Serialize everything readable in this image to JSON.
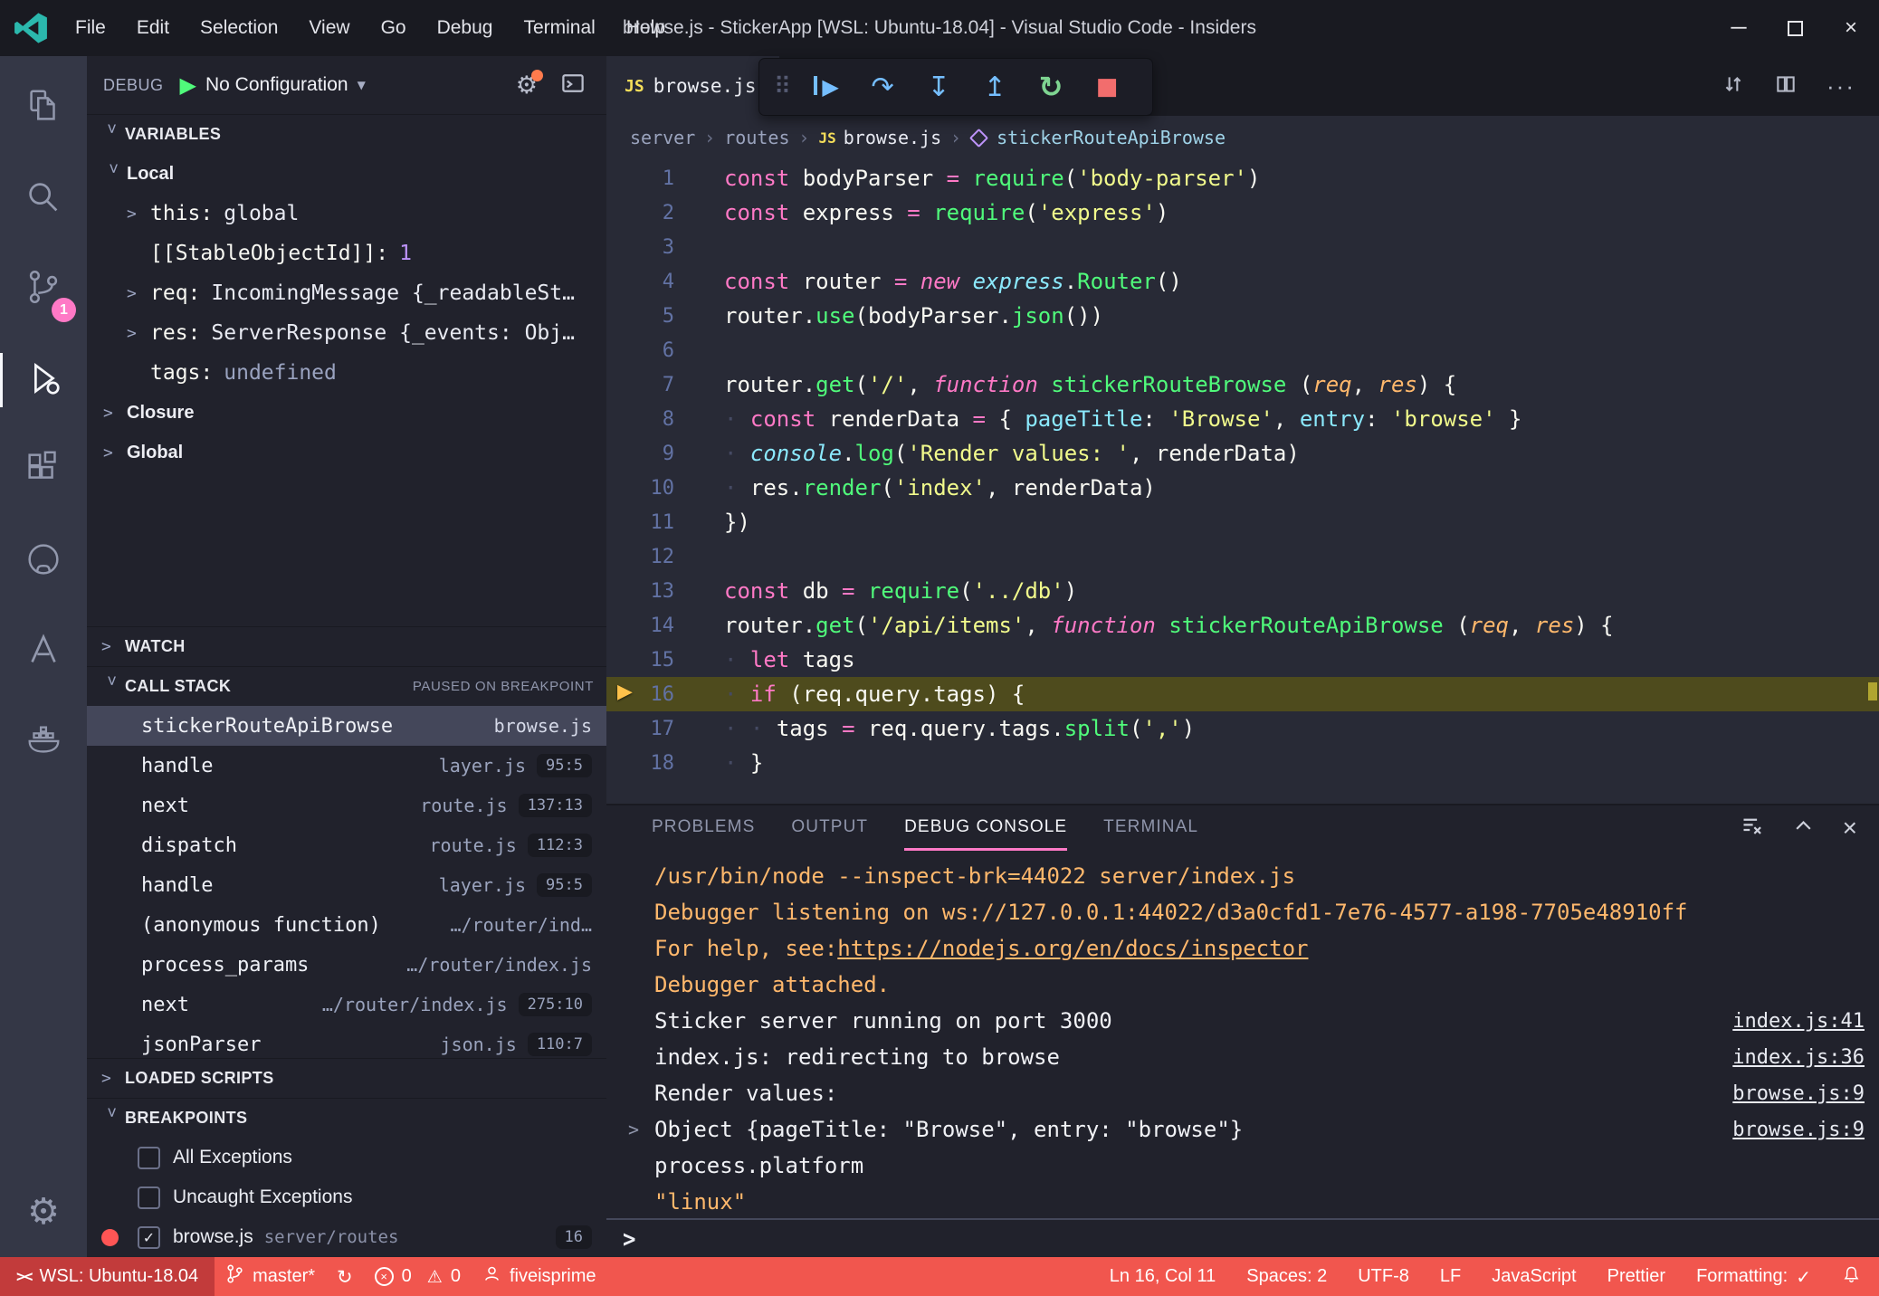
{
  "colors": {
    "title-bg": "#191a21",
    "activity-bg": "#343746",
    "side-bg": "#21222c",
    "editor-bg": "#282a36",
    "fg": "#f8f8f2",
    "dim": "#6272a4",
    "pink": "#ff79c6",
    "green": "#50fa7b",
    "yellow": "#f1fa8c",
    "orange": "#ffb86c",
    "purple": "#bd93f9",
    "cyan": "#8be9fd",
    "red": "#ff5555",
    "blue": "#75beff",
    "selection": "#44475a",
    "status-bg": "#f1564e",
    "status-remote-bg": "#c23b3b",
    "debug-line-bg": "#4e4b1d",
    "debug-arrow": "#ffc24b"
  },
  "title_bar": {
    "menus": [
      "File",
      "Edit",
      "Selection",
      "View",
      "Go",
      "Debug",
      "Terminal",
      "Help"
    ],
    "title": "browse.js - StickerApp [WSL: Ubuntu-18.04] - Visual Studio Code - Insiders"
  },
  "activity_bar": {
    "scm_badge": "1"
  },
  "debug_sidebar": {
    "header": {
      "label": "DEBUG",
      "config": "No Configuration"
    },
    "variables": {
      "title": "VARIABLES",
      "rows": [
        {
          "scope": true,
          "chev": "open",
          "label": "Local",
          "depth": 0
        },
        {
          "chev": "closed",
          "name": "this",
          "value": "global",
          "depth": 1
        },
        {
          "name": "[[StableObjectId]]",
          "value": "1",
          "depth": 1,
          "vc": "num"
        },
        {
          "chev": "closed",
          "name": "req",
          "value": "IncomingMessage {_readableSt…",
          "depth": 1
        },
        {
          "chev": "closed",
          "name": "res",
          "value": "ServerResponse {_events: Obj…",
          "depth": 1
        },
        {
          "name": "tags",
          "value": "undefined",
          "depth": 1,
          "vc": "undef"
        },
        {
          "scope": true,
          "chev": "closed",
          "label": "Closure",
          "depth": 0
        },
        {
          "scope": true,
          "chev": "closed",
          "label": "Global",
          "depth": 0
        }
      ]
    },
    "watch": {
      "title": "WATCH"
    },
    "call_stack": {
      "title": "CALL STACK",
      "status": "PAUSED ON BREAKPOINT",
      "frames": [
        {
          "name": "stickerRouteApiBrowse",
          "file": "browse.js",
          "selected": true
        },
        {
          "name": "handle",
          "file": "layer.js",
          "pos": "95:5"
        },
        {
          "name": "next",
          "file": "route.js",
          "pos": "137:13"
        },
        {
          "name": "dispatch",
          "file": "route.js",
          "pos": "112:3"
        },
        {
          "name": "handle",
          "file": "layer.js",
          "pos": "95:5"
        },
        {
          "name": "(anonymous function)",
          "file": "…/router/ind…"
        },
        {
          "name": "process_params",
          "file": "…/router/index.js"
        },
        {
          "name": "next",
          "file": "…/router/index.js",
          "pos": "275:10"
        },
        {
          "name": "jsonParser",
          "file": "json.js",
          "pos": "110:7"
        }
      ]
    },
    "loaded_scripts": {
      "title": "LOADED SCRIPTS"
    },
    "breakpoints": {
      "title": "BREAKPOINTS",
      "items": [
        {
          "label": "All Exceptions",
          "checked": false
        },
        {
          "label": "Uncaught Exceptions",
          "checked": false
        },
        {
          "label": "browse.js",
          "detail": "server/routes",
          "checked": true,
          "dot": true,
          "badge": "16"
        }
      ]
    }
  },
  "debug_toolbar": {
    "buttons": [
      {
        "name": "continue",
        "glyph": "▶",
        "color": "blue"
      },
      {
        "name": "step-over",
        "glyph": "↷",
        "color": "blue"
      },
      {
        "name": "step-into",
        "glyph": "↧",
        "color": "blue"
      },
      {
        "name": "step-out",
        "glyph": "↥",
        "color": "blue"
      },
      {
        "name": "restart",
        "glyph": "↻",
        "color": "green"
      },
      {
        "name": "stop",
        "glyph": "■",
        "color": "red"
      }
    ]
  },
  "editor": {
    "tab": {
      "label": "browse.js"
    },
    "js_badge": "JS",
    "breadcrumbs": [
      {
        "label": "server"
      },
      {
        "label": "routes"
      },
      {
        "label": "browse.js",
        "icon": "js"
      },
      {
        "label": "stickerRouteApiBrowse",
        "icon": "method"
      }
    ],
    "current_line": 16,
    "lines": [
      {
        "n": 1,
        "ind": 0,
        "t": [
          [
            "kw",
            "const"
          ],
          [
            "fg",
            " bodyParser "
          ],
          [
            "kw",
            "="
          ],
          [
            "fg",
            " "
          ],
          [
            "fn",
            "require"
          ],
          [
            "fg",
            "("
          ],
          [
            "str",
            "'body-parser'"
          ],
          [
            "fg",
            ")"
          ]
        ]
      },
      {
        "n": 2,
        "ind": 0,
        "t": [
          [
            "kw",
            "const"
          ],
          [
            "fg",
            " express "
          ],
          [
            "kw",
            "="
          ],
          [
            "fg",
            " "
          ],
          [
            "fn",
            "require"
          ],
          [
            "fg",
            "("
          ],
          [
            "str",
            "'express'"
          ],
          [
            "fg",
            ")"
          ]
        ]
      },
      {
        "n": 3,
        "ind": 0,
        "t": []
      },
      {
        "n": 4,
        "ind": 0,
        "t": [
          [
            "kw",
            "const"
          ],
          [
            "fg",
            " router "
          ],
          [
            "kw",
            "="
          ],
          [
            "fg",
            " "
          ],
          [
            "kwi",
            "new"
          ],
          [
            "fg",
            " "
          ],
          [
            "itc",
            "express"
          ],
          [
            "fg",
            "."
          ],
          [
            "fn",
            "Router"
          ],
          [
            "fg",
            "()"
          ]
        ]
      },
      {
        "n": 5,
        "ind": 0,
        "t": [
          [
            "fg",
            "router."
          ],
          [
            "fn",
            "use"
          ],
          [
            "fg",
            "(bodyParser."
          ],
          [
            "fn",
            "json"
          ],
          [
            "fg",
            "())"
          ]
        ]
      },
      {
        "n": 6,
        "ind": 0,
        "t": []
      },
      {
        "n": 7,
        "ind": 0,
        "t": [
          [
            "fg",
            "router."
          ],
          [
            "fn",
            "get"
          ],
          [
            "fg",
            "("
          ],
          [
            "str",
            "'/'"
          ],
          [
            "fg",
            ", "
          ],
          [
            "kwi",
            "function"
          ],
          [
            "fg",
            " "
          ],
          [
            "fn",
            "stickerRouteBrowse"
          ],
          [
            "fg",
            " ("
          ],
          [
            "ito",
            "req"
          ],
          [
            "fg",
            ", "
          ],
          [
            "ito",
            "res"
          ],
          [
            "fg",
            ") {"
          ]
        ]
      },
      {
        "n": 8,
        "ind": 1,
        "t": [
          [
            "kw",
            "const"
          ],
          [
            "fg",
            " renderData "
          ],
          [
            "kw",
            "="
          ],
          [
            "fg",
            " { "
          ],
          [
            "prop",
            "pageTitle"
          ],
          [
            "fg",
            ": "
          ],
          [
            "str",
            "'Browse'"
          ],
          [
            "fg",
            ", "
          ],
          [
            "prop",
            "entry"
          ],
          [
            "fg",
            ": "
          ],
          [
            "str",
            "'browse'"
          ],
          [
            "fg",
            " }"
          ]
        ]
      },
      {
        "n": 9,
        "ind": 1,
        "t": [
          [
            "itc",
            "console"
          ],
          [
            "fg",
            "."
          ],
          [
            "fn",
            "log"
          ],
          [
            "fg",
            "("
          ],
          [
            "str",
            "'Render values: '"
          ],
          [
            "fg",
            ", renderData)"
          ]
        ]
      },
      {
        "n": 10,
        "ind": 1,
        "t": [
          [
            "fg",
            "res."
          ],
          [
            "fn",
            "render"
          ],
          [
            "fg",
            "("
          ],
          [
            "str",
            "'index'"
          ],
          [
            "fg",
            ", renderData)"
          ]
        ]
      },
      {
        "n": 11,
        "ind": 0,
        "t": [
          [
            "fg",
            "})"
          ]
        ]
      },
      {
        "n": 12,
        "ind": 0,
        "t": []
      },
      {
        "n": 13,
        "ind": 0,
        "t": [
          [
            "kw",
            "const"
          ],
          [
            "fg",
            " db "
          ],
          [
            "kw",
            "="
          ],
          [
            "fg",
            " "
          ],
          [
            "fn",
            "require"
          ],
          [
            "fg",
            "("
          ],
          [
            "str",
            "'../db'"
          ],
          [
            "fg",
            ")"
          ]
        ]
      },
      {
        "n": 14,
        "ind": 0,
        "t": [
          [
            "fg",
            "router."
          ],
          [
            "fn",
            "get"
          ],
          [
            "fg",
            "("
          ],
          [
            "str",
            "'/api/items'"
          ],
          [
            "fg",
            ", "
          ],
          [
            "kwi",
            "function"
          ],
          [
            "fg",
            " "
          ],
          [
            "fn",
            "stickerRouteApiBrowse"
          ],
          [
            "fg",
            " ("
          ],
          [
            "ito",
            "req"
          ],
          [
            "fg",
            ", "
          ],
          [
            "ito",
            "res"
          ],
          [
            "fg",
            ") {"
          ]
        ]
      },
      {
        "n": 15,
        "ind": 1,
        "t": [
          [
            "kw",
            "let"
          ],
          [
            "fg",
            " tags"
          ]
        ]
      },
      {
        "n": 16,
        "ind": 1,
        "current": true,
        "t": [
          [
            "kw",
            "if"
          ],
          [
            "fg",
            " (req.query.tags) {"
          ]
        ]
      },
      {
        "n": 17,
        "ind": 2,
        "t": [
          [
            "fg",
            "tags "
          ],
          [
            "kw",
            "="
          ],
          [
            "fg",
            " req.query.tags."
          ],
          [
            "fn",
            "split"
          ],
          [
            "fg",
            "("
          ],
          [
            "str",
            "','"
          ],
          [
            "fg",
            ")"
          ]
        ]
      },
      {
        "n": 18,
        "ind": 1,
        "t": [
          [
            "fg",
            "}"
          ]
        ]
      }
    ]
  },
  "panel": {
    "tabs": [
      {
        "label": "PROBLEMS"
      },
      {
        "label": "OUTPUT"
      },
      {
        "label": "DEBUG CONSOLE",
        "active": true
      },
      {
        "label": "TERMINAL"
      }
    ],
    "console": [
      {
        "text": "/usr/bin/node --inspect-brk=44022 server/index.js",
        "cls": "orange"
      },
      {
        "text": "Debugger listening on ws://127.0.0.1:44022/d3a0cfd1-7e76-4577-a198-7705e48910ff",
        "cls": "orange"
      },
      {
        "text": "For help, see: ",
        "cls": "orange",
        "link": "https://nodejs.org/en/docs/inspector"
      },
      {
        "text": "Debugger attached.",
        "cls": "orange"
      },
      {
        "text": "Sticker server running on port 3000",
        "cls": "fg",
        "source": "index.js:41"
      },
      {
        "text": "index.js: redirecting to browse",
        "cls": "fg",
        "source": "index.js:36"
      },
      {
        "text": "Render values: ",
        "cls": "fg",
        "source": "browse.js:9"
      },
      {
        "text": "Object {pageTitle: \"Browse\", entry: \"browse\"}",
        "cls": "fg",
        "chevron": true,
        "source": "browse.js:9"
      },
      {
        "text": "process.platform",
        "cls": "fg"
      },
      {
        "text": "\"linux\"",
        "cls": "orange"
      }
    ]
  },
  "status_bar": {
    "remote": "WSL: Ubuntu-18.04",
    "branch": "master*",
    "errors": "0",
    "warnings": "0",
    "account": "fiveisprime",
    "line_col": "Ln 16, Col 11",
    "indent": "Spaces: 2",
    "encoding": "UTF-8",
    "eol": "LF",
    "language": "JavaScript",
    "formatter": "Prettier",
    "formatting_label": "Formatting:"
  }
}
